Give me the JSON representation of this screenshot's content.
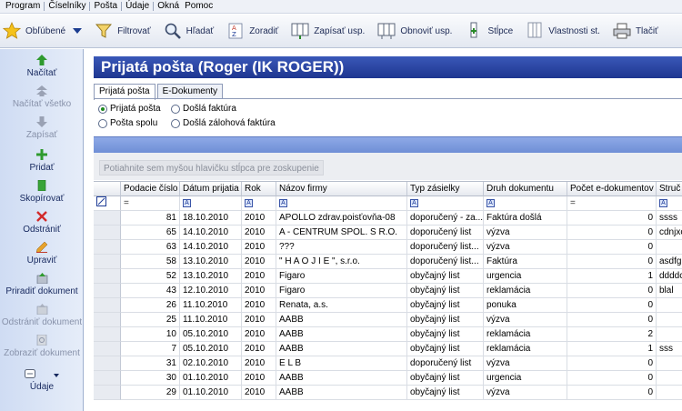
{
  "menu": [
    "Program",
    "Číselníky",
    "Pošta",
    "Údaje",
    "Okná",
    "Pomoc"
  ],
  "toolbar": {
    "favorites": "Obľúbené",
    "filter": "Filtrovať",
    "search": "Hľadať",
    "sort": "Zoradiť",
    "save_settings": "Zapísať usp.",
    "restore_settings": "Obnoviť usp.",
    "columns": "Stĺpce",
    "properties": "Vlastnosti st.",
    "print": "Tlačiť"
  },
  "sidebar": {
    "load": "Načítať",
    "load_all": "Načítať všetko",
    "save": "Zapísať",
    "add": "Pridať",
    "copy": "Skopírovať",
    "delete": "Odstrániť",
    "edit": "Upraviť",
    "attach_document": "Priradiť dokument",
    "remove_document": "Odstrániť dokument",
    "show_document": "Zobraziť dokument",
    "data": "Údaje"
  },
  "window": {
    "title": "Prijatá pošta (Roger (IK ROGER))"
  },
  "tabs": [
    "Prijatá pošta",
    "E-Dokumenty"
  ],
  "radios": {
    "received": "Prijatá pošta",
    "received_invoice": "Došlá faktúra",
    "all": "Pošta spolu",
    "received_advance": "Došlá zálohová faktúra",
    "selected": "received"
  },
  "group_hint": "Potiahnite sem myšou hlavičku stĺpca pre zoskupenie",
  "grid": {
    "headers": [
      "Podacie číslo",
      "Dátum prijatia",
      "Rok",
      "Názov firmy",
      "Typ zásielky",
      "Druh dokumentu",
      "Počet e-dokumentov",
      "Struč"
    ],
    "filter_eq": "=",
    "filter_a": "A",
    "rows": [
      [
        "81",
        "18.10.2010",
        "2010",
        "APOLLO zdrav.poisťovňa-08",
        "doporučený - za...",
        "Faktúra došlá",
        "0",
        "ssss"
      ],
      [
        "65",
        "14.10.2010",
        "2010",
        "A - CENTRUM SPOL. S R.O.",
        "doporučený list",
        "výzva",
        "0",
        "cdnjxc"
      ],
      [
        "63",
        "14.10.2010",
        "2010",
        "???",
        "doporučený list...",
        "výzva",
        "0",
        ""
      ],
      [
        "58",
        "13.10.2010",
        "2010",
        "\" H A O J I E \", s.r.o.",
        "doporučený list...",
        "Faktúra",
        "0",
        "asdfg"
      ],
      [
        "52",
        "13.10.2010",
        "2010",
        "Figaro",
        "obyčajný list",
        "urgencia",
        "1",
        "ddddc"
      ],
      [
        "43",
        "12.10.2010",
        "2010",
        "Figaro",
        "obyčajný list",
        "reklamácia",
        "0",
        "blal"
      ],
      [
        "26",
        "11.10.2010",
        "2010",
        "Renata, a.s.",
        "obyčajný list",
        "ponuka",
        "0",
        ""
      ],
      [
        "25",
        "11.10.2010",
        "2010",
        "AABB",
        "obyčajný list",
        "výzva",
        "0",
        ""
      ],
      [
        "10",
        "05.10.2010",
        "2010",
        "AABB",
        "obyčajný list",
        "reklamácia",
        "2",
        ""
      ],
      [
        "7",
        "05.10.2010",
        "2010",
        "AABB",
        "obyčajný list",
        "reklamácia",
        "1",
        "sss"
      ],
      [
        "31",
        "02.10.2010",
        "2010",
        "E L B",
        "doporučený list",
        "výzva",
        "0",
        ""
      ],
      [
        "30",
        "01.10.2010",
        "2010",
        "AABB",
        "obyčajný list",
        "urgencia",
        "0",
        ""
      ],
      [
        "29",
        "01.10.2010",
        "2010",
        "AABB",
        "obyčajný list",
        "výzva",
        "0",
        ""
      ]
    ]
  },
  "colors": {
    "title_bar": "#2a46a4",
    "accent_blue_bar": "#7f9be0",
    "sidebar": "#dce5f6"
  }
}
